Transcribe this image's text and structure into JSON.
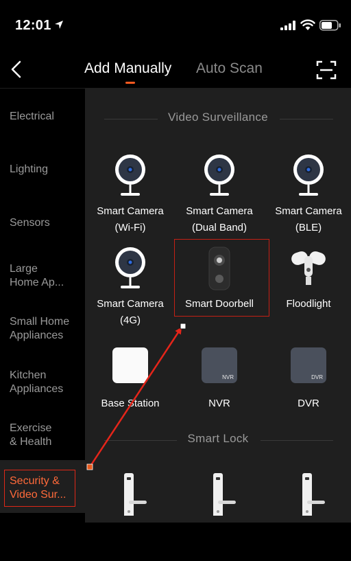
{
  "status": {
    "time": "12:01",
    "icons": [
      "location-arrow-icon",
      "signal-icon",
      "wifi-icon",
      "battery-icon"
    ]
  },
  "nav": {
    "back_icon": "chevron-left-icon",
    "tab_manual": "Add Manually",
    "tab_auto": "Auto Scan",
    "active_tab": "Add Manually",
    "scan_icon": "scan-frame-icon",
    "accent": "#ff5a20"
  },
  "sidebar": {
    "items": [
      {
        "label": "Electrical"
      },
      {
        "label": "Lighting"
      },
      {
        "label": "Sensors"
      },
      {
        "label": "Large\nHome Ap..."
      },
      {
        "label": "Small Home\nAppliances"
      },
      {
        "label": "Kitchen\nAppliances"
      },
      {
        "label": "Exercise\n& Health"
      },
      {
        "label": "Security &\nVideo Sur..."
      }
    ],
    "active_index": 7,
    "active_color": "#ff6a3a"
  },
  "sections": [
    {
      "title": "Video Surveillance",
      "devices": [
        {
          "label": "Smart Camera\n(Wi-Fi)",
          "icon": "camera-icon"
        },
        {
          "label": "Smart Camera\n(Dual Band)",
          "icon": "camera-icon"
        },
        {
          "label": "Smart Camera\n(BLE)",
          "icon": "camera-icon"
        },
        {
          "label": "Smart Camera\n(4G)",
          "icon": "camera-icon"
        },
        {
          "label": "Smart Doorbell",
          "icon": "doorbell-icon"
        },
        {
          "label": "Floodlight",
          "icon": "floodlight-icon"
        },
        {
          "label": "Base Station",
          "icon": "base-station-icon"
        },
        {
          "label": "NVR",
          "icon": "nvr-icon",
          "badge": "NVR"
        },
        {
          "label": "DVR",
          "icon": "dvr-icon",
          "badge": "DVR"
        }
      ]
    },
    {
      "title": "Smart Lock",
      "devices": [
        {
          "icon": "smart-lock-icon"
        },
        {
          "icon": "smart-lock-icon"
        },
        {
          "icon": "smart-lock-icon"
        }
      ]
    }
  ],
  "annotation": {
    "highlighted_device": "Smart Doorbell",
    "highlight_color": "#c62015",
    "arrow_color": "#e5251a"
  }
}
